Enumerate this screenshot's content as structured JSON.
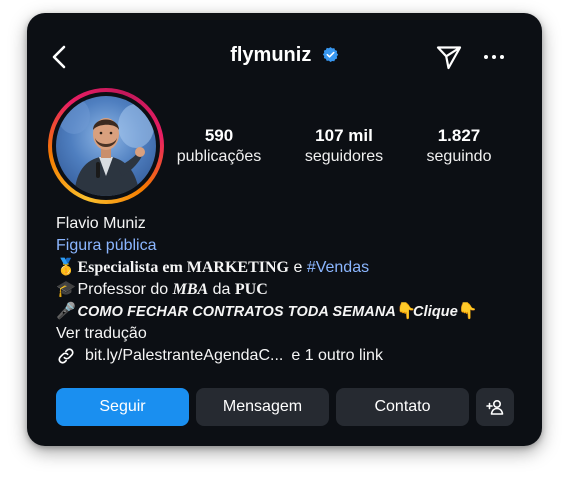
{
  "header": {
    "username": "flymuniz",
    "verified": true,
    "icons": [
      "back-arrow-icon",
      "verified-badge-icon",
      "send-icon",
      "more-options-icon"
    ]
  },
  "stats": {
    "posts": {
      "value": "590",
      "label": "publicações"
    },
    "followers": {
      "value": "107 mil",
      "label": "seguidores"
    },
    "following": {
      "value": "1.827",
      "label": "seguindo"
    }
  },
  "bio": {
    "full_name": "Flavio Muniz",
    "category": "Figura pública",
    "line1": {
      "emoji": "🥇",
      "bold_text": "Especialista em MARKETING",
      "connector": "e",
      "hashtag": "#Vendas"
    },
    "line2": {
      "emoji": "🎓",
      "prefix": "Professor do",
      "mba": "MBA",
      "middle": "da",
      "puc": "PUC"
    },
    "line3": {
      "emoji": "🎤",
      "text": "COMO FECHAR CONTRATOS TODA SEMANA",
      "emoji2": "👇",
      "clique": "Clique",
      "emoji3": "👇"
    },
    "see_translation": "Ver tradução",
    "link_text": "bit.ly/PalestranteAgendaC...",
    "more_links": "e 1 outro link"
  },
  "buttons": {
    "follow": "Seguir",
    "message": "Mensagem",
    "contact": "Contato"
  },
  "colors": {
    "background": "#0c0f14",
    "primary_button": "#1a8ff0",
    "secondary_button": "#262a31",
    "link_blue": "#8bb6ff",
    "verified_blue": "#3897f0"
  }
}
